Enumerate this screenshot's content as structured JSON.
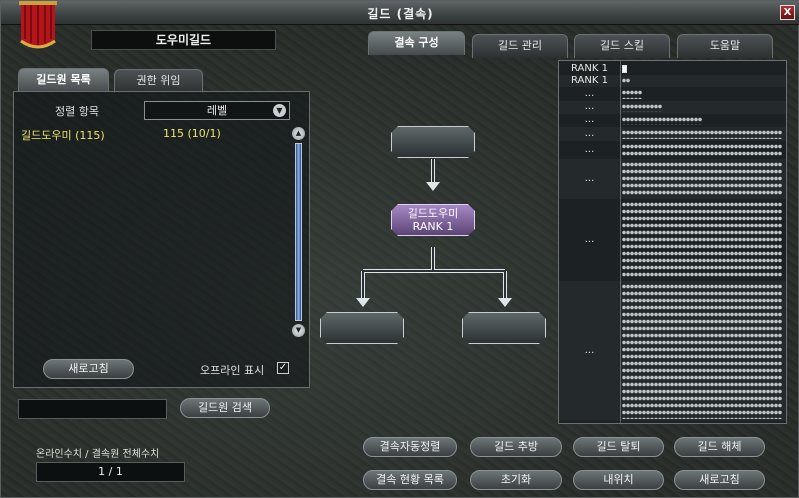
{
  "window": {
    "title": "길드 (결속)",
    "close_label": "X"
  },
  "guild_name": "도우미길드",
  "top_tabs": [
    {
      "label": "결속 구성",
      "active": true
    },
    {
      "label": "길드 관리",
      "active": false
    },
    {
      "label": "길드 스킬",
      "active": false
    },
    {
      "label": "도움말",
      "active": false
    }
  ],
  "left_tabs": [
    {
      "label": "길드원 목록",
      "active": true
    },
    {
      "label": "권한 위임",
      "active": false
    }
  ],
  "sort": {
    "label": "정렬 항목",
    "selected": "레벨"
  },
  "members": [
    {
      "name": "길드도우미 (115)",
      "level": "115 (10/1)"
    }
  ],
  "refresh_label": "새로고침",
  "offline": {
    "label": "오프라인 표시",
    "checked": true
  },
  "search": {
    "value": "",
    "button_label": "길드원 검색"
  },
  "counts": {
    "label": "온라인수치 / 결속원 전체수치",
    "value": "1 / 1"
  },
  "tree": {
    "parent": {
      "name": "",
      "rank": ""
    },
    "self": {
      "name": "길드도우미",
      "rank": "RANK 1"
    },
    "children": [
      {
        "name": ""
      },
      {
        "name": ""
      }
    ]
  },
  "rank_rows": [
    {
      "label": "RANK 1",
      "dots": 1
    },
    {
      "label": "RANK 1",
      "dots": 2
    },
    {
      "label": "...",
      "dots": 5
    },
    {
      "label": "...",
      "dots": 10
    },
    {
      "label": "...",
      "dots": 20
    },
    {
      "label": "...",
      "dots": 40
    },
    {
      "label": "...",
      "dots": 40
    },
    {
      "label": "...",
      "dots": 40
    },
    {
      "label": "...",
      "dots": 40
    },
    {
      "label": "...",
      "dots": 40
    }
  ],
  "bottom_buttons": {
    "row1": [
      "결속자동정렬",
      "길드 추방",
      "길드 탈퇴",
      "길드 해체"
    ],
    "row2": [
      "결속 현황 목록",
      "초기화",
      "내위치",
      "새로고침"
    ]
  },
  "colors": {
    "member_highlight": "#f0e36a",
    "self_node": "#a788c6"
  }
}
